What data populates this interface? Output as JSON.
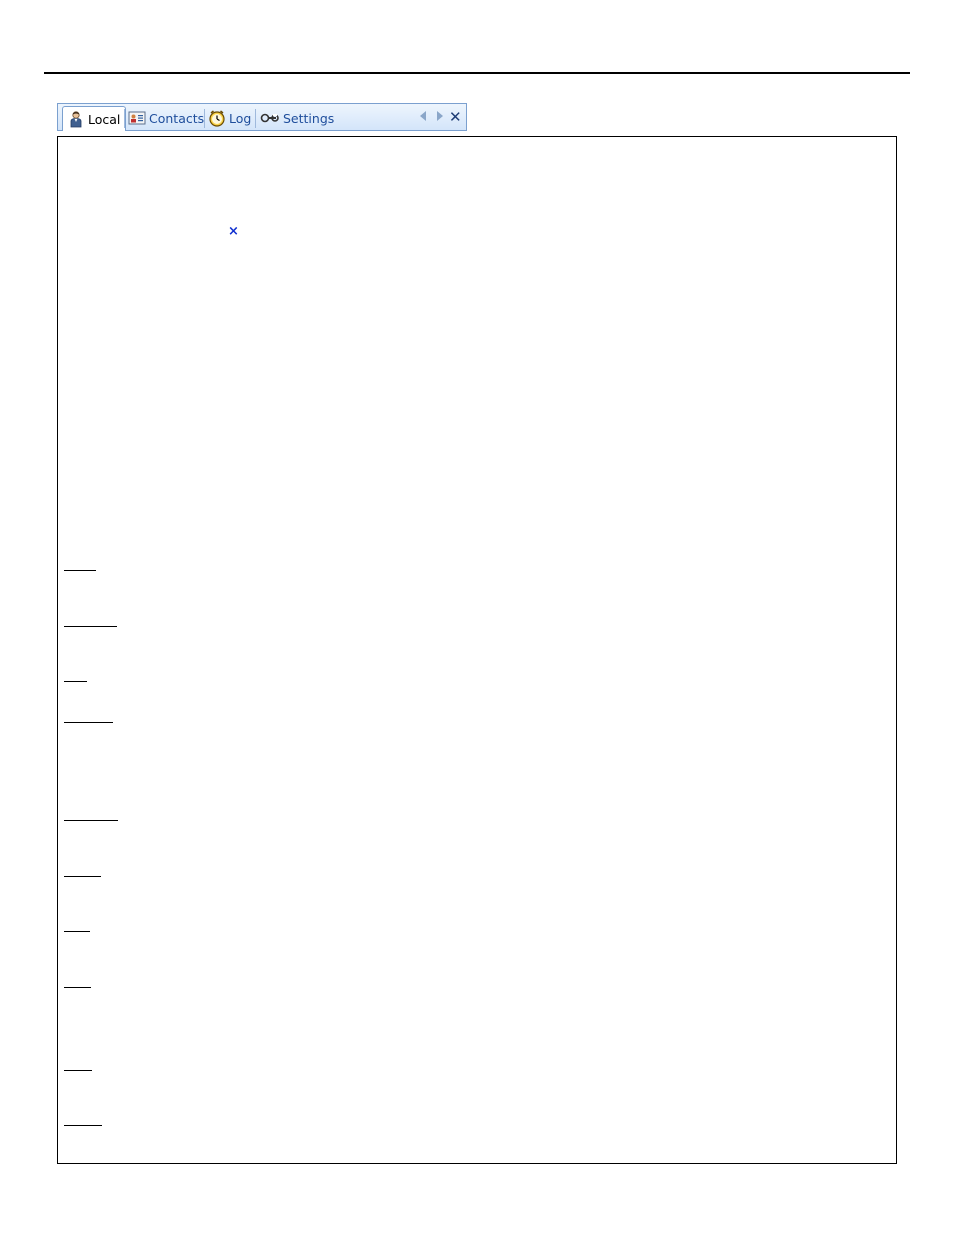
{
  "tabs": [
    {
      "label": "Local",
      "icon": "person-icon",
      "active": true
    },
    {
      "label": "Contacts",
      "icon": "contacts-card-icon",
      "active": false
    },
    {
      "label": "Log",
      "icon": "clock-icon",
      "active": false
    },
    {
      "label": "Settings",
      "icon": "tools-icon",
      "active": false
    }
  ],
  "nav": {
    "close_glyph": "✕"
  },
  "marker": {
    "glyph": "×"
  },
  "colors": {
    "tab_text": "#1f4e9c",
    "tab_bar_border": "#7ba0cf",
    "marker": "#1030d0"
  }
}
